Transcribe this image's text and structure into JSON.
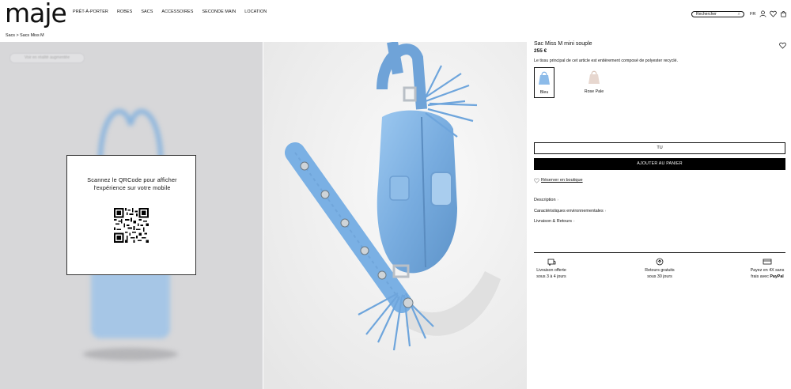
{
  "header": {
    "logo": "maje",
    "nav": [
      "PRÊT-À-PORTER",
      "ROBES",
      "SACS",
      "ACCESSOIRES",
      "SECONDE MAIN",
      "LOCATION"
    ],
    "search_placeholder": "Rechercher",
    "lang": "FR"
  },
  "breadcrumb": "Sacs > Sacs Miss M",
  "viewer": {
    "ar_button": "Voir en réalité augmentée",
    "qr_text_line1": "Scannez le QRCode pour afficher",
    "qr_text_line2": "l'expérience sur votre mobile"
  },
  "product": {
    "title": "Sac Miss M mini souple",
    "price": "255 €",
    "description": "Le tissu principal de cet article est entièrement composé de polyester recyclé.",
    "colors": [
      {
        "label": "Bleu",
        "hex": "#7fb2e6",
        "selected": true
      },
      {
        "label": "Rose Pale",
        "hex": "#e7d7cf",
        "selected": false
      }
    ],
    "size": "TU",
    "add_to_cart": "AJOUTER AU PANIER",
    "reserve": "Réserver en boutique",
    "accordions": [
      "Description",
      "Caractéristiques environnementales",
      "Livraison & Retours"
    ]
  },
  "services": [
    {
      "icon": "delivery-box-icon",
      "line1": "Livraison offerte",
      "line2": "sous 3 à 4 jours"
    },
    {
      "icon": "returns-icon",
      "line1": "Retours gratuits",
      "line2": "sous 30 jours"
    },
    {
      "icon": "card-icon",
      "line1": "Payez en 4X sans",
      "line2_prefix": "frais avec ",
      "line2_brand": "PayPal"
    }
  ],
  "colors": {
    "accent_blue": "#7fb2e6",
    "panel_grey": "#d7d7d9",
    "black": "#000000"
  }
}
